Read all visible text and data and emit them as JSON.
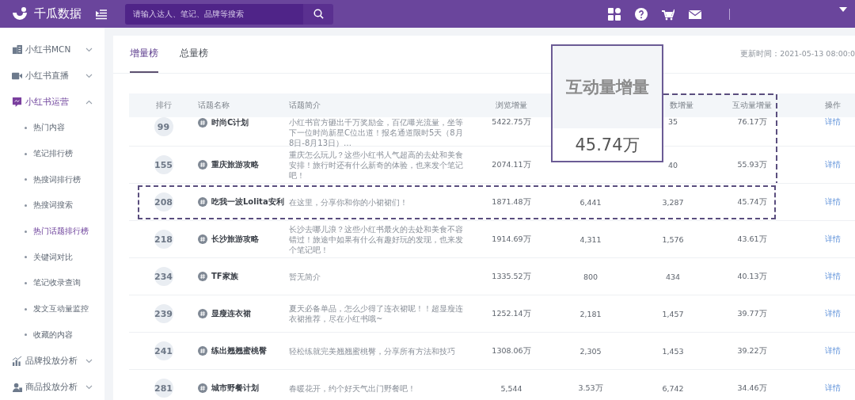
{
  "topbar": {
    "brand": "千瓜数据",
    "search": {
      "placeholder": "请输入达人、笔记、品牌等搜索"
    }
  },
  "sidebar": {
    "items": [
      {
        "label": "小红书MCN",
        "expanded": false
      },
      {
        "label": "小红书直播",
        "expanded": false
      },
      {
        "label": "小红书运营",
        "expanded": true,
        "children": [
          {
            "label": "热门内容",
            "selected": false
          },
          {
            "label": "笔记排行榜",
            "selected": false
          },
          {
            "label": "热搜词排行榜",
            "selected": false
          },
          {
            "label": "热搜词搜索",
            "selected": false
          },
          {
            "label": "热门话题排行榜",
            "selected": true
          },
          {
            "label": "关键词对比",
            "selected": false
          },
          {
            "label": "笔记收录查询",
            "selected": false
          },
          {
            "label": "发文互动量监控",
            "selected": false
          },
          {
            "label": "收藏的内容",
            "selected": false
          }
        ]
      },
      {
        "label": "品牌投放分析",
        "expanded": false
      },
      {
        "label": "商品投放分析",
        "expanded": false
      }
    ]
  },
  "tabs": [
    {
      "label": "增量榜",
      "selected": true
    },
    {
      "label": "总量榜",
      "selected": false
    }
  ],
  "update_time": "更新时间：2021-05-13 08:00:0",
  "callout": {
    "title": "互动量增量",
    "value": "45.74万"
  },
  "table": {
    "columns": [
      "排行",
      "话题名称",
      "话题简介",
      "浏览增量",
      "数增量",
      "互动量增量",
      "操作"
    ],
    "rows": [
      {
        "rank": "99",
        "name": "时尚C计划",
        "intro": "小红书官方砸出千万奖励金，百亿曝光流量，坐等下一位时尚新星C位出道！报名通道限时5天（8月8日-8月13日）…",
        "views": "5422.75万",
        "column_6": "35",
        "interactions": "76.17万",
        "action": "详情",
        "highlighted": false
      },
      {
        "rank": "155",
        "name": "重庆旅游攻略",
        "intro": "重庆怎么玩儿？这些小红书人气超高的去处和美食安排！旅行时还有什么新奇的体验，也来发个笔记吧！",
        "views": "2074.11万",
        "column_6": "40",
        "interactions": "55.93万",
        "action": "详情",
        "highlighted": false
      },
      {
        "rank": "208",
        "name": "吃我一波Lolita安利",
        "intro": "在这里，分享你和你的小裙裙们！",
        "views": "1871.48万",
        "column_5": "6,441",
        "column_6": "3,287",
        "interactions": "45.74万",
        "action": "详情",
        "highlighted": true
      },
      {
        "rank": "218",
        "name": "长沙旅游攻略",
        "intro": "长沙去哪儿浪？这些小红书最火的去处和美食不容错过！旅途中如果有什么有趣好玩的发现，也来发个笔记吧！",
        "views": "1914.69万",
        "column_5": "4,311",
        "column_6": "1,576",
        "interactions": "43.61万",
        "action": "详情",
        "highlighted": false
      },
      {
        "rank": "234",
        "name": "TF家族",
        "intro": "暂无简介",
        "views": "1335.52万",
        "column_5": "800",
        "column_6": "434",
        "interactions": "40.13万",
        "action": "详情",
        "highlighted": false
      },
      {
        "rank": "239",
        "name": "显瘦连衣裙",
        "intro": "夏天必备单品，怎么少得了连衣裙呢！！超显瘦连衣裙推荐，尽在小红书哦~",
        "views": "1252.14万",
        "column_5": "2,181",
        "column_6": "1,457",
        "interactions": "39.77万",
        "action": "详情",
        "highlighted": false
      },
      {
        "rank": "241",
        "name": "练出翘翘蜜桃臀",
        "intro": "轻松练就完美翘翘蜜桃臀，分享所有方法和技巧",
        "views": "1308.06万",
        "column_5": "2,305",
        "column_6": "1,453",
        "interactions": "39.22万",
        "action": "详情",
        "highlighted": false
      },
      {
        "rank": "281",
        "name": "城市野餐计划",
        "intro": "春暖花开，约个好天气出门野餐吧！",
        "views": "5,544",
        "column_5": "3.53万",
        "column_6": "6,742",
        "interactions": "34.46万",
        "action": "详情",
        "highlighted": false
      }
    ]
  }
}
